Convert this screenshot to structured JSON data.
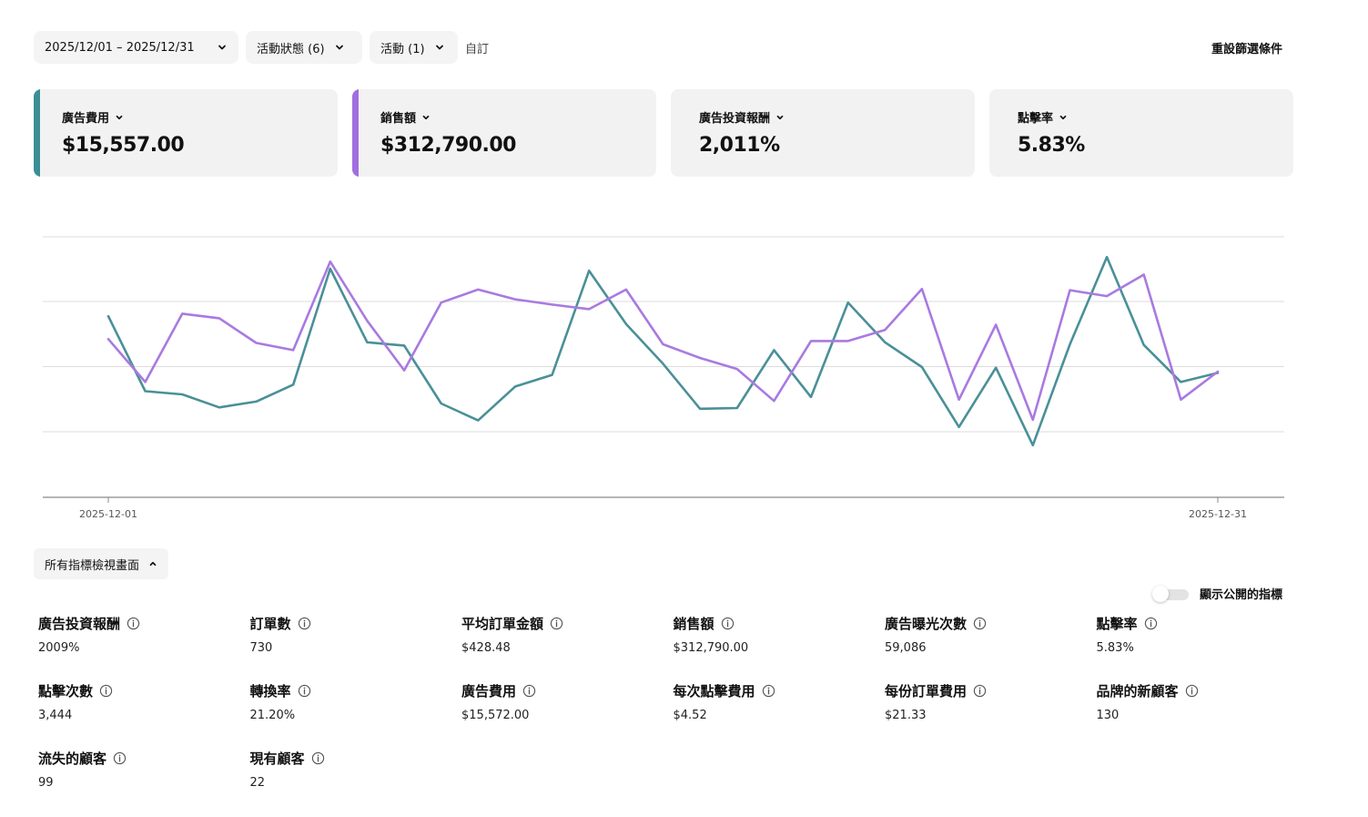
{
  "filters": {
    "date_range": "2025/12/01 – 2025/12/31",
    "campaign_status": "活動狀態 (6)",
    "campaigns": "活動 (1)",
    "custom": "自訂",
    "reset": "重設篩選條件"
  },
  "cards": [
    {
      "label": "廣告費用",
      "value": "$15,557.00",
      "accent": "#3a8f96"
    },
    {
      "label": "銷售額",
      "value": "$312,790.00",
      "accent": "#a06ee0"
    },
    {
      "label": "廣告投資報酬",
      "value": "2,011%",
      "accent": ""
    },
    {
      "label": "點擊率",
      "value": "5.83%",
      "accent": ""
    }
  ],
  "chart_data": {
    "type": "line",
    "x_start_label": "2025-12-01",
    "x_end_label": "2025-12-31",
    "grid": true,
    "series": [
      {
        "color": "#4a9098",
        "values": [
          2.78,
          1.63,
          1.58,
          1.38,
          1.47,
          1.73,
          3.51,
          2.38,
          2.33,
          1.44,
          1.18,
          1.7,
          1.88,
          3.48,
          2.66,
          2.05,
          1.36,
          1.37,
          2.26,
          1.54,
          2.99,
          2.38,
          2.0,
          1.08,
          1.99,
          0.8,
          2.35,
          3.69,
          2.34,
          1.77,
          1.91
        ]
      },
      {
        "color": "#a97ae0",
        "values": [
          2.43,
          1.77,
          2.82,
          2.75,
          2.37,
          2.26,
          3.62,
          2.71,
          1.95,
          2.99,
          3.19,
          3.04,
          2.96,
          2.89,
          3.19,
          2.35,
          2.14,
          1.97,
          1.48,
          2.4,
          2.4,
          2.57,
          3.2,
          1.5,
          2.65,
          1.19,
          3.18,
          3.09,
          3.42,
          1.5,
          1.93
        ]
      }
    ]
  },
  "view_toggle": "所有指標檢視畫面",
  "public_toggle": "顯示公開的指標",
  "metrics": [
    {
      "label": "廣告投資報酬",
      "value": "2009%"
    },
    {
      "label": "訂單數",
      "value": "730"
    },
    {
      "label": "平均訂單金額",
      "value": "$428.48"
    },
    {
      "label": "銷售額",
      "value": "$312,790.00"
    },
    {
      "label": "廣告曝光次數",
      "value": "59,086"
    },
    {
      "label": "點擊率",
      "value": "5.83%"
    },
    {
      "label": "點擊次數",
      "value": "3,444"
    },
    {
      "label": "轉換率",
      "value": "21.20%"
    },
    {
      "label": "廣告費用",
      "value": "$15,572.00"
    },
    {
      "label": "每次點擊費用",
      "value": "$4.52"
    },
    {
      "label": "每份訂單費用",
      "value": "$21.33"
    },
    {
      "label": "品牌的新顧客",
      "value": "130"
    },
    {
      "label": "流失的顧客",
      "value": "99"
    },
    {
      "label": "現有顧客",
      "value": "22"
    }
  ]
}
